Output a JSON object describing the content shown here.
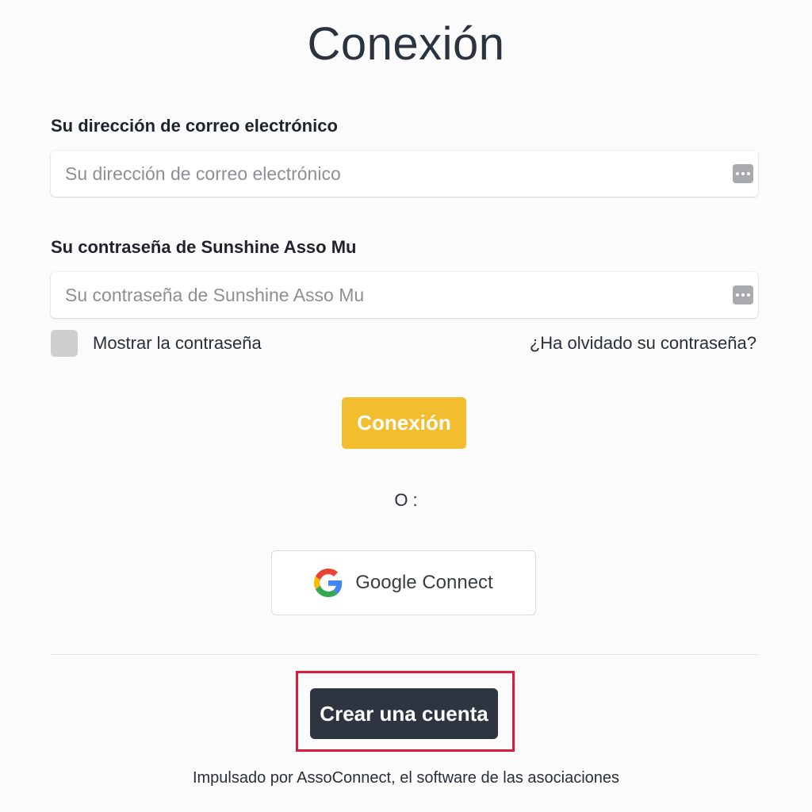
{
  "page": {
    "title": "Conexión"
  },
  "email": {
    "label": "Su dirección de correo electrónico",
    "placeholder": "Su dirección de correo electrónico",
    "value": "",
    "icon": "password-manager-icon"
  },
  "password": {
    "label": "Su contraseña de Sunshine Asso Mu",
    "placeholder": "Su contraseña de Sunshine Asso Mu",
    "value": "",
    "icon": "password-manager-icon"
  },
  "options": {
    "show_password_label": "Mostrar la contraseña",
    "show_password_checked": false,
    "forgot_password_label": "¿Ha olvidado su contraseña?"
  },
  "actions": {
    "login_label": "Conexión",
    "or_label": "O :",
    "google_label": "Google Connect",
    "create_account_label": "Crear una cuenta"
  },
  "footer": {
    "text": "Impulsado por AssoConnect, el software de las asociaciones"
  },
  "colors": {
    "primary": "#f3bd30",
    "dark_button": "#2f3540",
    "highlight": "#e0193a",
    "checkbox": "#cfcfcf"
  }
}
